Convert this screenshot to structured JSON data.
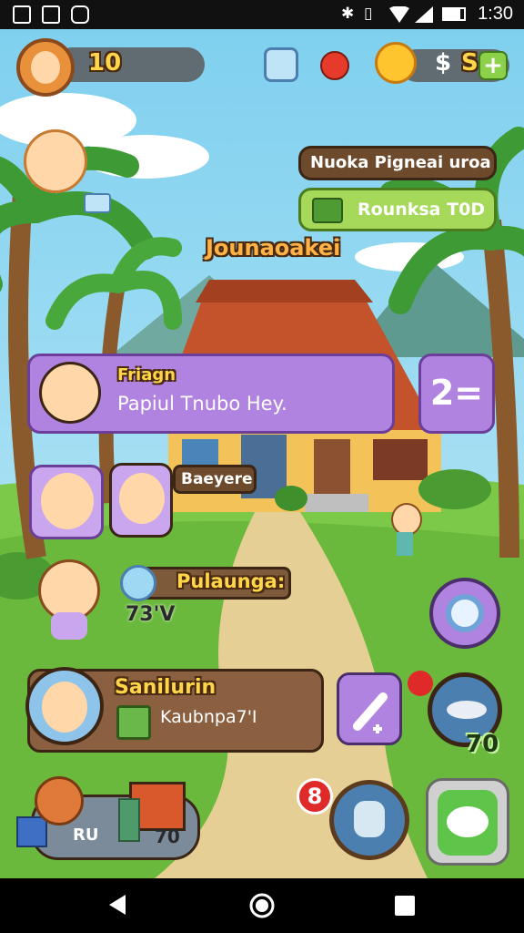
{
  "status_bar": {
    "time": "1:30"
  },
  "hud": {
    "coins": "10",
    "currency_symbol": "$",
    "currency_value": "S",
    "add_symbol": "+"
  },
  "banner_event": "Nuoka Pigneai uroa",
  "banner_reward": "Rounksa T0D",
  "building_sign": "Jounaoakei",
  "message": {
    "name": "Friagn",
    "text": "Papiul Tnubo Hey.",
    "badge": "2="
  },
  "friend_tag": "Baeyere",
  "resource_tag": "Pulaunga:",
  "resource_value": "73'V",
  "profile": {
    "name": "Sanilurin",
    "detail": "Kaubnpa7'I"
  },
  "fish_count": "70",
  "notification_count": "8",
  "inventory": {
    "count_left": "RU",
    "count_right": "70"
  },
  "colors": {
    "sky": "#8fd6f0",
    "grass": "#7cc94a",
    "accent_purple": "#a46fd6",
    "accent_green": "#8bd14a",
    "wood_brown": "#6d4a2c"
  }
}
